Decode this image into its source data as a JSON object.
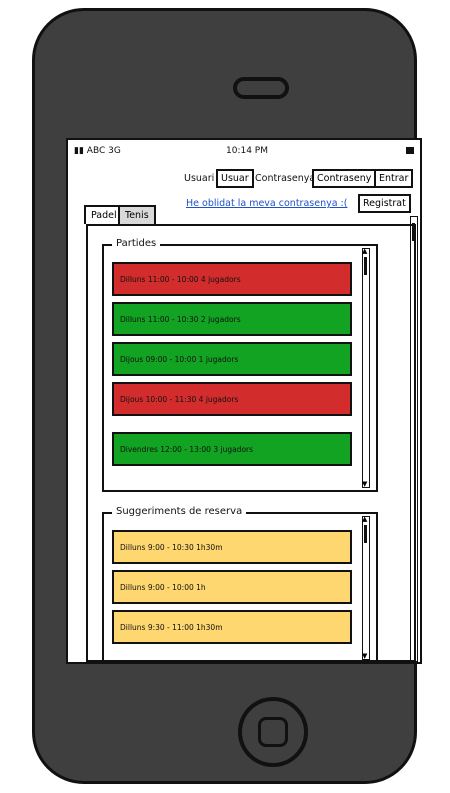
{
  "statusbar": {
    "carrier": "ABC 3G",
    "time": "10:14 PM"
  },
  "login": {
    "user_label": "Usuari",
    "user_value": "Usuar",
    "password_label": "Contrasenya",
    "password_value": "Contraseny",
    "login_button": "Entrar",
    "forgot_link": "He oblidat la meva contrasenya :(",
    "register_button": "Registrat"
  },
  "tabs": [
    {
      "label": "Padel",
      "active": true
    },
    {
      "label": "Tenis",
      "active": false
    }
  ],
  "matches": {
    "title": "Partides",
    "items": [
      {
        "text": "Dilluns 11:00 - 10:00 4 jugadors",
        "color": "#d32c2c"
      },
      {
        "text": "Dilluns 11:00 - 10:30 2 jugadors",
        "color": "#11a321"
      },
      {
        "text": "Dijous 09:00 - 10:00 1 jugadors",
        "color": "#11a321"
      },
      {
        "text": "Dijous 10:00 - 11:30 4 jugadors",
        "color": "#d32c2c"
      },
      {
        "text": "Divendres 12:00 - 13:00 3 jugadors",
        "color": "#11a321"
      }
    ]
  },
  "suggestions": {
    "title": "Suggeriments de reserva",
    "items": [
      {
        "text": "Dilluns 9:00 - 10:30 1h30m",
        "color": "#ffd770"
      },
      {
        "text": "Dilluns 9:00 - 10:00 1h",
        "color": "#ffd770"
      },
      {
        "text": "Dilluns 9:30 - 11:00 1h30m",
        "color": "#ffd770"
      }
    ]
  },
  "icons": {
    "signal": "signal-bars-icon",
    "battery": "battery-icon",
    "scroll_up": "chevron-up-icon",
    "scroll_down": "chevron-down-icon"
  }
}
